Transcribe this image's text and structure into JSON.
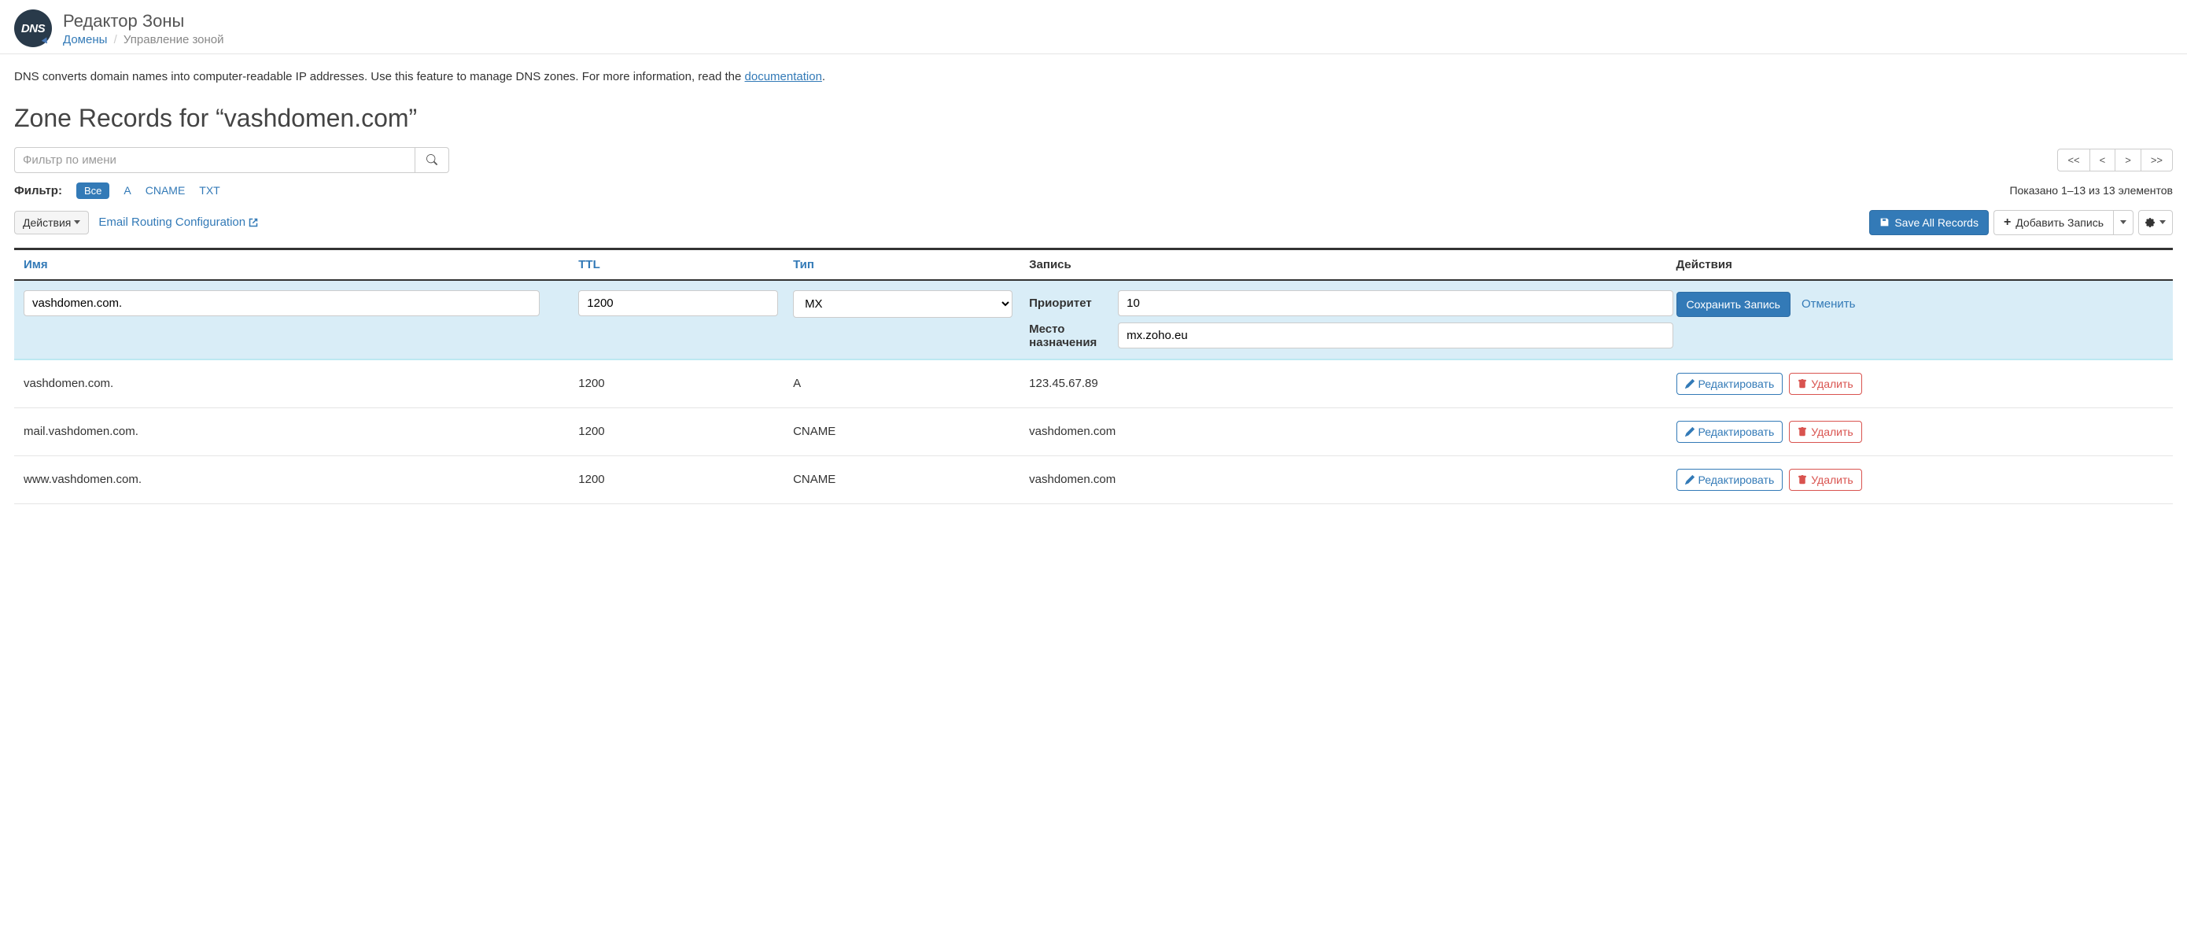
{
  "header": {
    "title": "Редактор Зоны",
    "breadcrumb_domains": "Домены",
    "breadcrumb_current": "Управление зоной"
  },
  "intro": {
    "text_before": "DNS converts domain names into computer-readable IP addresses. Use this feature to manage DNS zones. For more information, read the ",
    "doc_link": "documentation",
    "text_after": "."
  },
  "zone_title": "Zone Records for “vashdomen.com”",
  "filter": {
    "placeholder": "Фильтр по имени",
    "label": "Фильтр:",
    "all": "Все",
    "a": "A",
    "cname": "CNAME",
    "txt": "TXT"
  },
  "pager": {
    "first": "<<",
    "prev": "<",
    "next": ">",
    "last": ">>"
  },
  "count_text": "Показано 1–13 из 13 элементов",
  "actions": {
    "dropdown": "Действия",
    "email_routing": "Email Routing Configuration",
    "save_all": "Save All Records",
    "add_record": "Добавить Запись"
  },
  "columns": {
    "name": "Имя",
    "ttl": "TTL",
    "type": "Тип",
    "record": "Запись",
    "actions": "Действия"
  },
  "edit": {
    "name": "vashdomen.com.",
    "ttl": "1200",
    "type": "MX",
    "priority_label": "Приоритет",
    "priority_value": "10",
    "destination_label": "Место назначения",
    "destination_value": "mx.zoho.eu",
    "save": "Сохранить Запись",
    "cancel": "Отменить"
  },
  "rows": [
    {
      "name": "vashdomen.com.",
      "ttl": "1200",
      "type": "A",
      "record": "123.45.67.89"
    },
    {
      "name": "mail.vashdomen.com.",
      "ttl": "1200",
      "type": "CNAME",
      "record": "vashdomen.com"
    },
    {
      "name": "www.vashdomen.com.",
      "ttl": "1200",
      "type": "CNAME",
      "record": "vashdomen.com"
    }
  ],
  "row_buttons": {
    "edit": "Редактировать",
    "delete": "Удалить"
  }
}
